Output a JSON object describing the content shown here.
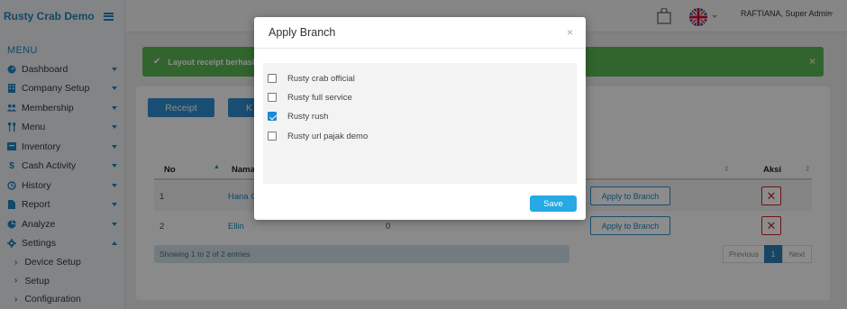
{
  "app": {
    "brand": "Rusty Crab Demo"
  },
  "sidebar": {
    "menu_title": "MENU",
    "items": [
      {
        "label": "Dashboard",
        "icon": "dashboard-icon"
      },
      {
        "label": "Company Setup",
        "icon": "building-icon"
      },
      {
        "label": "Membership",
        "icon": "users-icon"
      },
      {
        "label": "Menu",
        "icon": "cutlery-icon"
      },
      {
        "label": "Inventory",
        "icon": "box-icon"
      },
      {
        "label": "Cash Activity",
        "icon": "dollar-icon"
      },
      {
        "label": "History",
        "icon": "history-icon"
      },
      {
        "label": "Report",
        "icon": "file-icon"
      },
      {
        "label": "Analyze",
        "icon": "pie-chart-icon"
      },
      {
        "label": "Settings",
        "icon": "gear-icon"
      }
    ],
    "sub_items": [
      {
        "label": "Device Setup"
      },
      {
        "label": "Setup"
      },
      {
        "label": "Configuration"
      }
    ]
  },
  "topbar": {
    "user": "RAFTIANA, Super Admin"
  },
  "alert": {
    "text": "Layout receipt berhasil d",
    "close": "×"
  },
  "tabs": {
    "receipt": "Receipt",
    "second": "K"
  },
  "table": {
    "headers": {
      "no": "No",
      "name": "Nama",
      "aksi": "Aksi"
    },
    "rows": [
      {
        "no": "1",
        "name": "Hana C",
        "value": "",
        "action": "Apply to Branch"
      },
      {
        "no": "2",
        "name": "Ellin",
        "value": "0",
        "action": "Apply to Branch"
      }
    ],
    "info": "Showing 1 to 2 of 2 entries",
    "pager": {
      "previous": "Previous",
      "current": "1",
      "next": "Next"
    }
  },
  "modal": {
    "title": "Apply Branch",
    "close": "×",
    "options": [
      {
        "label": "Rusty crab official",
        "checked": false
      },
      {
        "label": "Rusty full service",
        "checked": false
      },
      {
        "label": "Rusty rush",
        "checked": true
      },
      {
        "label": "Rusty url pajak demo",
        "checked": false
      }
    ],
    "save": "Save"
  },
  "colors": {
    "primary": "#2f8fcf",
    "success": "#59b852",
    "danger": "#cc2222",
    "save": "#26a9e4"
  }
}
